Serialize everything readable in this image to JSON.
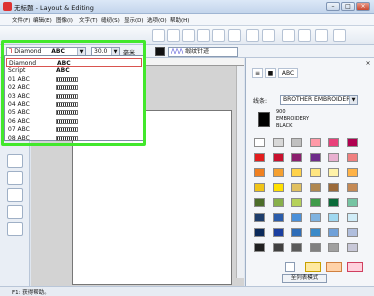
{
  "window": {
    "title": "无标题 - Layout & Editing",
    "minimize": "–",
    "maximize": "□",
    "close": "×"
  },
  "menu": [
    "文件(F)",
    "编辑(E)",
    "图像(I)",
    "文字(T)",
    "缝纫(S)",
    "显示(D)",
    "选项(O)",
    "帮助(H)"
  ],
  "fontbar": {
    "font_value": "Diamond",
    "font_preview": "ABC",
    "size_value": "30.0",
    "size_unit": "毫米",
    "stitch_type": "缎纹针迹"
  },
  "dropdown": {
    "items": [
      {
        "name": "Diamond",
        "preview": "ABC",
        "selected": true
      },
      {
        "name": "Script",
        "preview": "ABC"
      },
      {
        "name": "01 ABC",
        "preview": ""
      },
      {
        "name": "02 ABC",
        "preview": ""
      },
      {
        "name": "03 ABC",
        "preview": ""
      },
      {
        "name": "04 ABC",
        "preview": ""
      },
      {
        "name": "05 ABC",
        "preview": ""
      },
      {
        "name": "06 ABC",
        "preview": ""
      },
      {
        "name": "07 ABC",
        "preview": ""
      },
      {
        "name": "08 ABC",
        "preview": ""
      }
    ]
  },
  "right_panel": {
    "tabs": [
      "≡",
      "■",
      "ABC"
    ],
    "thread_label": "线条:",
    "thread_value": "BROTHER EMBROIDERY",
    "color_caption_1": "900",
    "color_caption_2": "EMBROIDERY",
    "color_caption_3": "BLACK",
    "apply_button": "至列表模式",
    "swatch_colors": [
      "#ffffff",
      "#d8d8d8",
      "#c0c0c0",
      "#ff9aa8",
      "#e8407a",
      "#b00050",
      "#e21d1d",
      "#c8102e",
      "#8a1f6e",
      "#6e2c8a",
      "#e8b0d0",
      "#f08080",
      "#f08020",
      "#f5a030",
      "#ffd24a",
      "#ffe680",
      "#fff2a8",
      "#ffb347",
      "#f0c418",
      "#ffe000",
      "#e0c060",
      "#b08850",
      "#9b6a3a",
      "#c58a55",
      "#4c6d2a",
      "#88b04b",
      "#b5d15a",
      "#3f9b4a",
      "#0b6b3a",
      "#76c4a2",
      "#1e3d6b",
      "#2a5caa",
      "#4a90d9",
      "#7fb3e0",
      "#a0d8f0",
      "#d0ecf7",
      "#0b2a5a",
      "#1a3fa0",
      "#2e6db8",
      "#3a8ac8",
      "#6fa0d8",
      "#b0bedd",
      "#202020",
      "#404040",
      "#5a5a5a",
      "#808080",
      "#a0a0a0",
      "#c8c8d8"
    ]
  },
  "status": {
    "text": "F1: 获得帮助。"
  }
}
